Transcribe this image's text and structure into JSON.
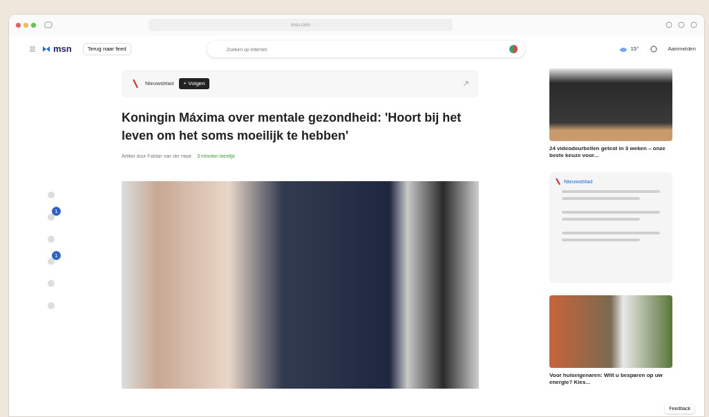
{
  "browser": {
    "url": "msn.com"
  },
  "header": {
    "logo": "msn",
    "back_button": "Terug naar feed",
    "search": {
      "placeholder": "Zoeken op internet"
    },
    "weather": "15°",
    "signin": "Aanmelden"
  },
  "article": {
    "publisher": "Nieuwsblad",
    "follow_button": "+ Volgen",
    "title": "Koningin Máxima over mentale gezondheid: 'Hoort bij het leven om het soms moeilijk te hebben'",
    "byline": "Artikel door Fabian van der Haar",
    "read_time": "3 minuten leestijd",
    "rail_badges": [
      {
        "count": "1"
      },
      {
        "count": "1"
      }
    ]
  },
  "sidebar": {
    "cards": [
      {
        "kind": "ad",
        "title": "24 videodeurbellen getest in 3 weken – onze beste keuze voor..."
      },
      {
        "kind": "list",
        "title": "Nieuwsblad"
      },
      {
        "kind": "ad",
        "title": "Voor huiseigenaren: Wilt u besparen op uw energie? Kies..."
      }
    ]
  },
  "feedback": "Feedback"
}
